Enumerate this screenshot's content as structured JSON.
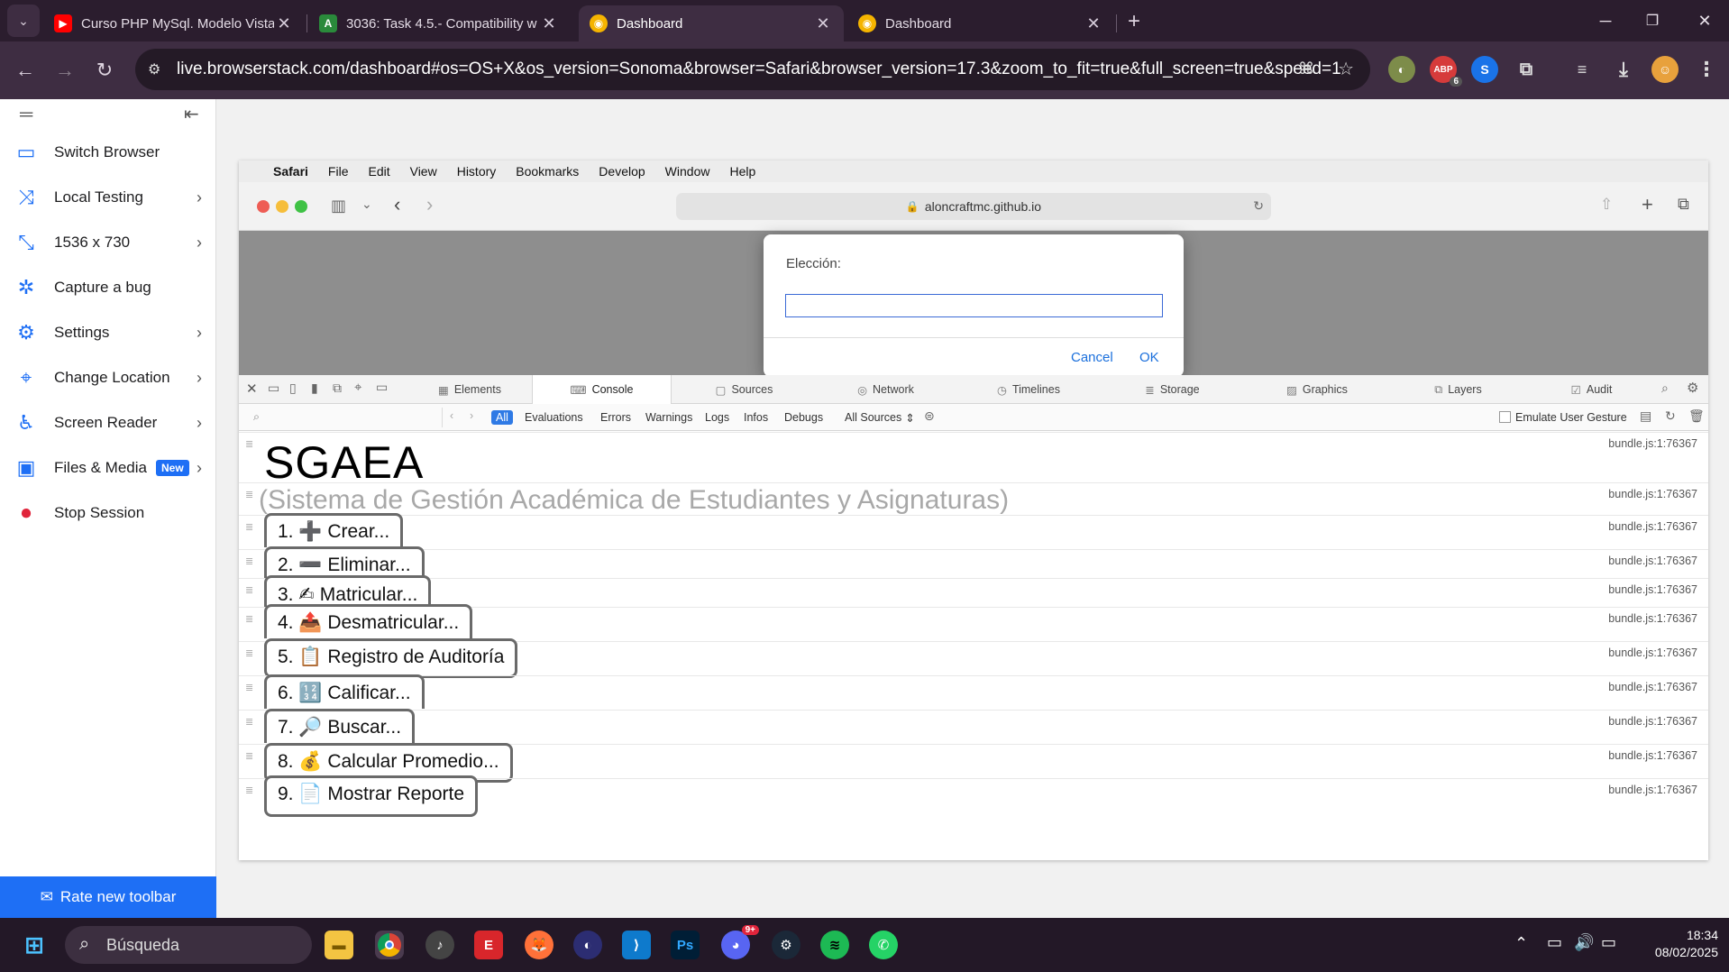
{
  "browser": {
    "tabs": [
      {
        "title": "Curso PHP MySql. Modelo Vista",
        "favicon": "youtube-icon",
        "active": false
      },
      {
        "title": "3036: Task 4.5.- Compatibility w",
        "favicon": "aula-icon",
        "active": false
      },
      {
        "title": "Dashboard",
        "favicon": "chrome-dashboard-icon",
        "active": true
      },
      {
        "title": "Dashboard",
        "favicon": "chrome-dashboard-icon",
        "active": false
      }
    ],
    "new_tab_label": "+",
    "url": "live.browserstack.com/dashboard#os=OS+X&os_version=Sonoma&browser=Safari&browser_version=17.3&zoom_to_fit=true&full_screen=true&speed=1",
    "extension_badge": "6",
    "notification_badge": "9+"
  },
  "bs_sidebar": {
    "items": [
      {
        "label": "Switch Browser",
        "icon": "switch-browser-icon",
        "chevron": false,
        "badge": ""
      },
      {
        "label": "Local Testing",
        "icon": "local-testing-icon",
        "chevron": true,
        "badge": ""
      },
      {
        "label": "1536 x 730",
        "icon": "resolution-icon",
        "chevron": true,
        "badge": ""
      },
      {
        "label": "Capture a bug",
        "icon": "bug-icon",
        "chevron": false,
        "badge": ""
      },
      {
        "label": "Settings",
        "icon": "gear-icon",
        "chevron": true,
        "badge": ""
      },
      {
        "label": "Change Location",
        "icon": "location-pin-icon",
        "chevron": true,
        "badge": ""
      },
      {
        "label": "Screen Reader",
        "icon": "accessibility-icon",
        "chevron": true,
        "badge": ""
      },
      {
        "label": "Files & Media",
        "icon": "image-icon",
        "chevron": true,
        "badge": "New"
      },
      {
        "label": "Stop Session",
        "icon": "stop-icon",
        "chevron": false,
        "badge": ""
      }
    ],
    "rate_label": "Rate new toolbar"
  },
  "mac": {
    "menubar": [
      "Safari",
      "File",
      "Edit",
      "View",
      "History",
      "Bookmarks",
      "Develop",
      "Window",
      "Help"
    ],
    "address": "aloncraftmc.github.io",
    "dialog": {
      "label": "Elección:",
      "value": "",
      "cancel": "Cancel",
      "ok": "OK"
    },
    "devtools_tabs": [
      "Elements",
      "Console",
      "Sources",
      "Network",
      "Timelines",
      "Storage",
      "Graphics",
      "Layers",
      "Audit"
    ],
    "filters": [
      "All",
      "Evaluations",
      "Errors",
      "Warnings",
      "Logs",
      "Infos",
      "Debugs",
      "All Sources"
    ],
    "emulate_label": "Emulate User Gesture",
    "console_rows": [
      {
        "text": "SGAEA",
        "source": "bundle.js:1:76367"
      },
      {
        "text": "(Sistema de Gestión Académica de Estudiantes y Asignaturas)",
        "source": "bundle.js:1:76367"
      },
      {
        "text": "1. ➕ Crear...",
        "source": "bundle.js:1:76367"
      },
      {
        "text": "2. ➖ Eliminar...",
        "source": "bundle.js:1:76367"
      },
      {
        "text": "3. ✍ Matricular...",
        "source": "bundle.js:1:76367"
      },
      {
        "text": "4. 📤 Desmatricular...",
        "source": "bundle.js:1:76367"
      },
      {
        "text": "5. 📋 Registro de Auditoría",
        "source": "bundle.js:1:76367"
      },
      {
        "text": "6. 🔢 Calificar...",
        "source": "bundle.js:1:76367"
      },
      {
        "text": "7. 🔎 Buscar...",
        "source": "bundle.js:1:76367"
      },
      {
        "text": "8. 💰 Calcular Promedio...",
        "source": "bundle.js:1:76367"
      },
      {
        "text": "9. 📄 Mostrar Reporte",
        "source": "bundle.js:1:76367"
      }
    ]
  },
  "taskbar": {
    "search_placeholder": "Búsqueda",
    "time": "18:34",
    "date": "08/02/2025"
  }
}
